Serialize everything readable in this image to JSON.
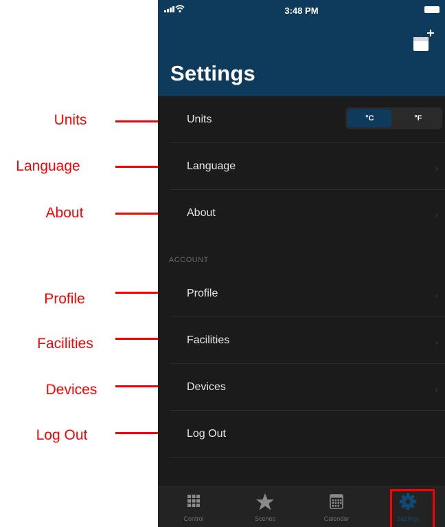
{
  "status_bar": {
    "time": "3:48 PM"
  },
  "header": {
    "title": "Settings"
  },
  "settings": {
    "units": {
      "label": "Units",
      "options": [
        "°C",
        "°F"
      ],
      "selected": "°C"
    },
    "language": {
      "label": "Language"
    },
    "about": {
      "label": "About"
    }
  },
  "account": {
    "section_label": "ACCOUNT",
    "profile": {
      "label": "Profile"
    },
    "facilities": {
      "label": "Facilities"
    },
    "devices": {
      "label": "Devices"
    },
    "logout": {
      "label": "Log Out"
    }
  },
  "tabs": [
    {
      "label": "Control",
      "icon": "grid-icon"
    },
    {
      "label": "Scenes",
      "icon": "star-icon"
    },
    {
      "label": "Calendar",
      "icon": "calendar-icon"
    },
    {
      "label": "Settings",
      "icon": "gear-icon",
      "active": true
    }
  ],
  "annotations": [
    "Units",
    "Language",
    "About",
    "Profile",
    "Facilities",
    "Devices",
    "Log Out"
  ],
  "colors": {
    "header_bg": "#0e3b5c",
    "list_bg": "#1b1b1b",
    "annotation": "#ff0000",
    "active_tab": "#0f4a75"
  }
}
